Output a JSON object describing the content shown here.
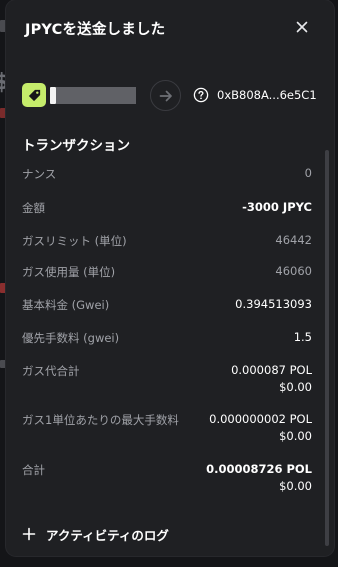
{
  "colors": {
    "modal_bg": "#1f2023",
    "account_icon_bg": "#c5ec6b",
    "label": "#a0a2a8",
    "value": "#ffffff"
  },
  "modal": {
    "title": "JPYCを送金しました",
    "close_icon": "close-icon"
  },
  "transfer": {
    "from_icon": "tag-icon",
    "arrow_icon": "arrow-right-icon",
    "to_icon": "help-circle-icon",
    "to_address": "0xB808A...6e5C1"
  },
  "transaction": {
    "section_title": "トランザクション",
    "rows": [
      {
        "label": "ナンス",
        "value": "0"
      },
      {
        "label": "金額",
        "value": "-3000 JPYC"
      },
      {
        "label": "ガスリミット (単位)",
        "value": "46442"
      },
      {
        "label": "ガス使用量 (単位)",
        "value": "46060"
      },
      {
        "label": "基本料金 (Gwei)",
        "value": "0.394513093"
      },
      {
        "label": "優先手数料 (gwei)",
        "value": "1.5"
      },
      {
        "label": "ガス代合計",
        "value": "0.000087 POL",
        "value2": "$0.00"
      },
      {
        "label": "ガス1単位あたりの最大手数料",
        "value": "0.000000002 POL",
        "value2": "$0.00"
      },
      {
        "label": "合計",
        "value": "0.00008726 POL",
        "value2": "$0.00"
      }
    ]
  },
  "activity": {
    "label": "アクティビティのログ",
    "icon": "plus-icon"
  }
}
